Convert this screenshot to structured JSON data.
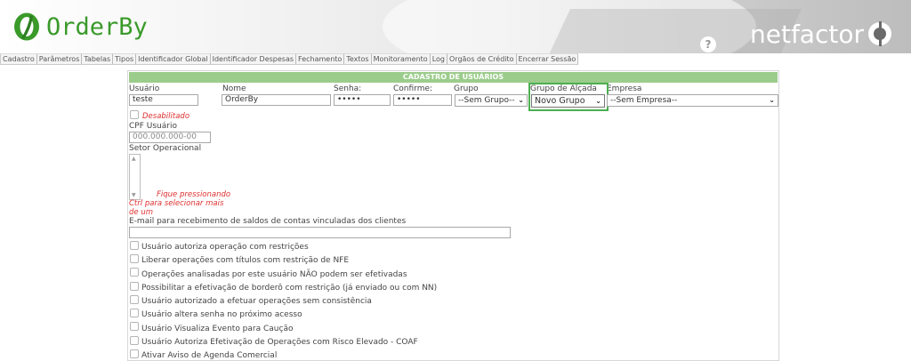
{
  "header": {
    "logo_text": "OrderBy",
    "netfactor_text": "netfactor",
    "help_label": "?",
    "colors": {
      "brand_green": "#3a9a2a",
      "title_bar": "#9ccc8c",
      "highlight": "#4caf50"
    }
  },
  "menu": [
    "Cadastro",
    "Parâmetros",
    "Tabelas",
    "Tipos",
    "Identificador Global",
    "Identificador Despesas",
    "Fechamento",
    "Textos",
    "Monitoramento",
    "Log",
    "Orgãos de Crédito",
    "Encerrar Sessão"
  ],
  "form": {
    "title": "CADASTRO DE USUÁRIOS",
    "usuario": {
      "label": "Usuário",
      "value": "teste"
    },
    "nome": {
      "label": "Nome",
      "value": "OrderBy"
    },
    "senha": {
      "label": "Senha:",
      "value": "•••••"
    },
    "confirme": {
      "label": "Confirme:",
      "value": "•••••"
    },
    "grupo": {
      "label": "Grupo",
      "selected": "--Sem Grupo--"
    },
    "grupo_alcada": {
      "label": "Grupo de Alçada",
      "selected": "Novo Grupo"
    },
    "empresa": {
      "label": "Empresa",
      "selected": "--Sem Empresa--"
    },
    "desabilitado": "Desabilitado",
    "cpf": {
      "label": "CPF Usuário",
      "placeholder": "000.000.000-00"
    },
    "setor": {
      "label": "Setor Operacional",
      "hint_1": "Fique pressionando",
      "hint_2": "Ctrl para selecionar mais",
      "hint_3": "de um"
    },
    "email": {
      "label": "E-mail para recebimento de saldos de contas vinculadas dos clientes",
      "value": ""
    },
    "checkboxes": [
      "Usuário autoriza operação com restrições",
      "Liberar operações com títulos com restrição de NFE",
      "Operações analisadas por este usuário NÃO podem ser efetivadas",
      "Possibilitar a efetivação de borderô com restrição (já enviado ou com NN)",
      "Usuário autorizado a efetuar operações sem consistência",
      "Usuário altera senha no próximo acesso",
      "Usuário Visualiza Evento para Caução",
      "Usuário Autoriza Efetivação de Operações com Risco Elevado - COAF",
      "Ativar Aviso de Agenda Comercial"
    ]
  }
}
